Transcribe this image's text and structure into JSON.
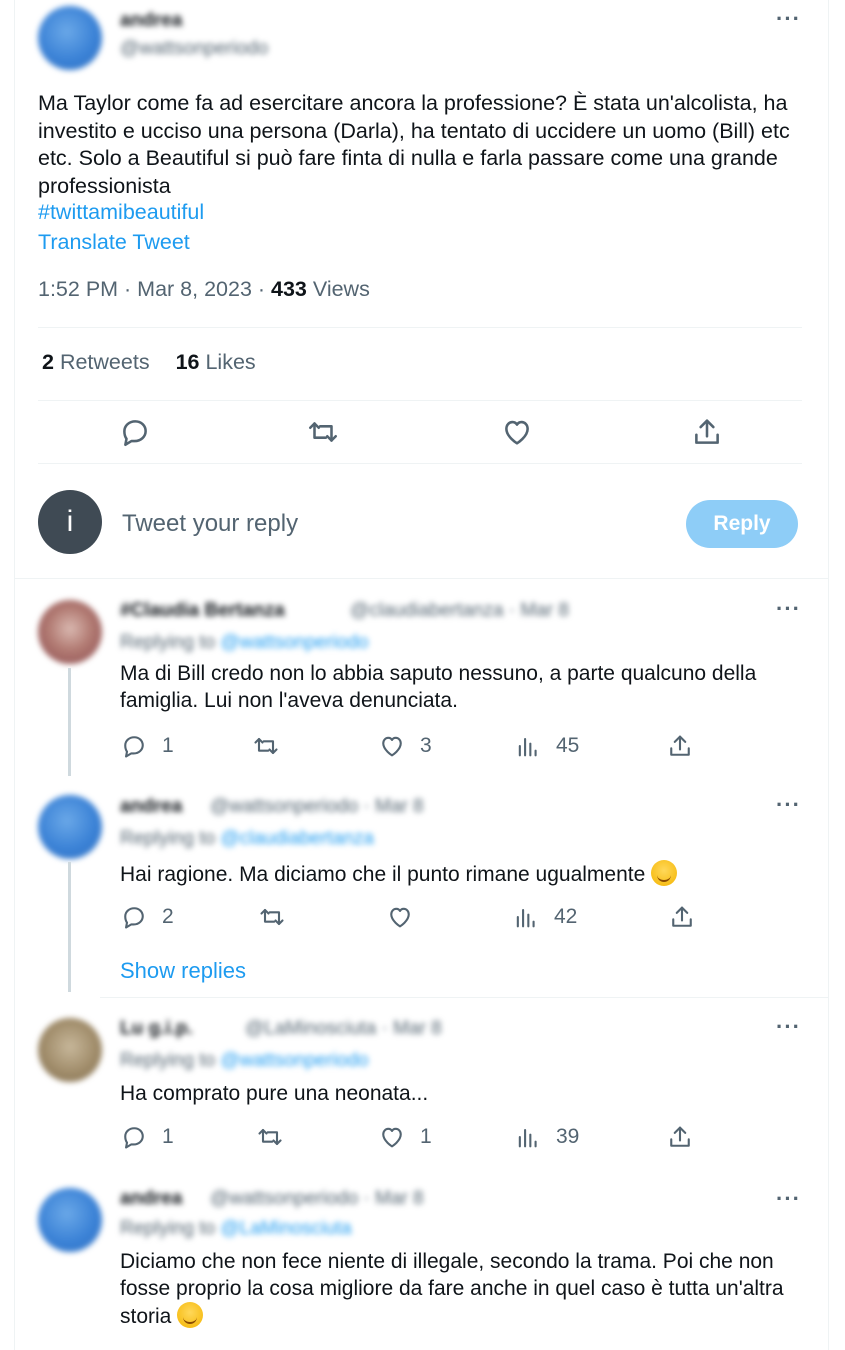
{
  "main_tweet": {
    "author_name": "andrea",
    "author_handle": "@wattsonperiodo",
    "text": "Ma Taylor come fa ad esercitare ancora la professione? È stata un'alcolista, ha investito e ucciso una persona (Darla), ha tentato di uccidere un uomo (Bill) etc etc. Solo a Beautiful si può fare finta di nulla e farla passare come una grande professionista",
    "hashtag": "#twittamibeautiful",
    "translate_label": "Translate Tweet",
    "time": "1:52 PM · Mar 8, 2023 · ",
    "views_count": "433",
    "views_label": " Views",
    "retweets_count": "2",
    "retweets_label": " Retweets",
    "likes_count": "16",
    "likes_label": " Likes",
    "more_label": "···"
  },
  "reply_box": {
    "avatar_letter": "i",
    "placeholder": "Tweet your reply",
    "button_label": "Reply"
  },
  "replies": [
    {
      "name": "#Claudia Bertanza",
      "handle_line": "@claudiabertanza · Mar 8",
      "replying_prefix": "Replying to ",
      "replying_to": "@wattsonperiodo",
      "text": "Ma di Bill credo non lo abbia saputo nessuno, a parte qualcuno della famiglia. Lui non l'aveva denunciata.",
      "replies": "1",
      "retweets": "",
      "likes": "3",
      "views": "45"
    },
    {
      "name": "andrea",
      "handle_line": "@wattsonperiodo · Mar 8",
      "replying_prefix": "Replying to ",
      "replying_to": "@claudiabertanza",
      "text": "Hai ragione. Ma diciamo che il punto rimane ugualmente",
      "replies": "2",
      "retweets": "",
      "likes": "",
      "views": "42"
    },
    {
      "name": "Lu g.i.p.",
      "handle_line": "@LaMinosciuta · Mar 8",
      "replying_prefix": "Replying to ",
      "replying_to": "@wattsonperiodo",
      "text": "Ha comprato pure una neonata...",
      "replies": "1",
      "retweets": "",
      "likes": "1",
      "views": "39"
    },
    {
      "name": "andrea",
      "handle_line": "@wattsonperiodo · Mar 8",
      "replying_prefix": "Replying to ",
      "replying_to": "@LaMinosciuta",
      "text": "Diciamo che non fece niente di illegale, secondo la trama. Poi che non fosse proprio la cosa migliore da fare anche in quel caso è tutta un'altra storia"
    }
  ],
  "show_replies_label": "Show replies",
  "icons": {
    "comment": "comment-icon",
    "retweet": "retweet-icon",
    "like": "heart-icon",
    "share": "share-icon",
    "views": "views-icon"
  },
  "colors": {
    "link": "#1d9bf0",
    "muted": "#536471",
    "reply_button": "#8ecdf7"
  }
}
